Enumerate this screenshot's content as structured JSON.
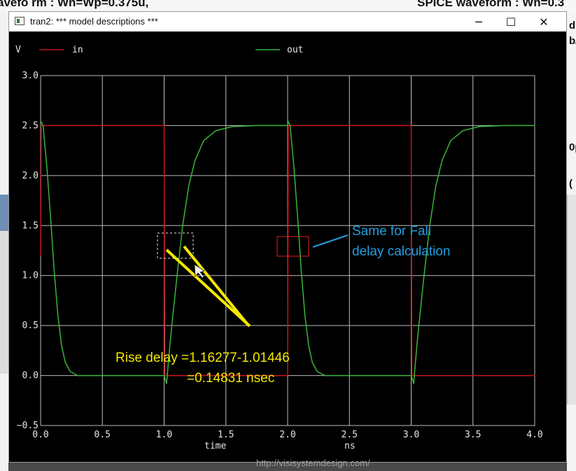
{
  "background": {
    "top_left_text": "avefo rm : Wn=Wp=0.375u,",
    "top_right_text": "SPICE waveform : Wn=0.3",
    "right_chars": [
      "d",
      "b/",
      "0p",
      "("
    ]
  },
  "window": {
    "title": "tran2: *** model descriptions ***",
    "minimize_icon": "─",
    "maximize_icon": "☐",
    "close_icon": "✕"
  },
  "watermark": "http://visisystemdesign.com/",
  "annotations": {
    "rise_line1": "Rise delay =1.16277-1.01446",
    "rise_line2": "=0.14831 nsec",
    "fall_line1": "Same for Fall",
    "fall_line2": "delay calculation",
    "rise_color": "#f5e800",
    "fall_color": "#1e9fe0"
  },
  "chart_data": {
    "type": "line",
    "ylabel": "V",
    "xlabel_left": "time",
    "xlabel_right": "ns",
    "xlim": [
      0,
      4
    ],
    "ylim": [
      -0.5,
      3
    ],
    "x_ticks": [
      0,
      0.5,
      1,
      1.5,
      2,
      2.5,
      3,
      3.5,
      4
    ],
    "x_tick_labels": [
      "0.0",
      "0.5",
      "1.0",
      "1.5",
      "2.0",
      "2.5",
      "3.0",
      "3.5",
      "4.0"
    ],
    "y_ticks": [
      -0.5,
      0,
      0.5,
      1,
      1.5,
      2,
      2.5,
      3
    ],
    "y_tick_labels": [
      "−0.5",
      "0.0",
      "0.5",
      "1.0",
      "1.5",
      "2.0",
      "2.5",
      "3.0"
    ],
    "grid": true,
    "legend_placement": "top",
    "series": [
      {
        "name": "in",
        "color": "#c8141e",
        "points": [
          [
            0,
            1.2
          ],
          [
            0.005,
            2.5
          ],
          [
            1.0,
            2.5
          ],
          [
            1.005,
            0.0
          ],
          [
            2.0,
            0.0
          ],
          [
            2.005,
            2.5
          ],
          [
            3.0,
            2.5
          ],
          [
            3.005,
            0.0
          ],
          [
            4.0,
            0.0
          ]
        ]
      },
      {
        "name": "out",
        "color": "#3ab43a",
        "points": [
          [
            0,
            2.55
          ],
          [
            0.02,
            2.5
          ],
          [
            0.05,
            2.1
          ],
          [
            0.08,
            1.6
          ],
          [
            0.11,
            1.05
          ],
          [
            0.14,
            0.6
          ],
          [
            0.17,
            0.3
          ],
          [
            0.2,
            0.13
          ],
          [
            0.24,
            0.04
          ],
          [
            0.3,
            0.0
          ],
          [
            1.0,
            0.0
          ],
          [
            1.02,
            -0.08
          ],
          [
            1.05,
            0.35
          ],
          [
            1.1,
            0.95
          ],
          [
            1.15,
            1.5
          ],
          [
            1.2,
            1.9
          ],
          [
            1.25,
            2.15
          ],
          [
            1.32,
            2.35
          ],
          [
            1.42,
            2.45
          ],
          [
            1.55,
            2.49
          ],
          [
            1.75,
            2.5
          ],
          [
            2.0,
            2.5
          ],
          [
            2.0,
            2.55
          ],
          [
            2.02,
            2.5
          ],
          [
            2.05,
            2.1
          ],
          [
            2.08,
            1.6
          ],
          [
            2.11,
            1.05
          ],
          [
            2.14,
            0.6
          ],
          [
            2.17,
            0.3
          ],
          [
            2.2,
            0.13
          ],
          [
            2.24,
            0.04
          ],
          [
            2.3,
            0.0
          ],
          [
            3.0,
            0.0
          ],
          [
            3.02,
            -0.08
          ],
          [
            3.05,
            0.35
          ],
          [
            3.1,
            0.95
          ],
          [
            3.15,
            1.5
          ],
          [
            3.2,
            1.9
          ],
          [
            3.25,
            2.15
          ],
          [
            3.32,
            2.35
          ],
          [
            3.42,
            2.45
          ],
          [
            3.55,
            2.49
          ],
          [
            3.75,
            2.5
          ],
          [
            4.0,
            2.5
          ]
        ]
      }
    ]
  }
}
